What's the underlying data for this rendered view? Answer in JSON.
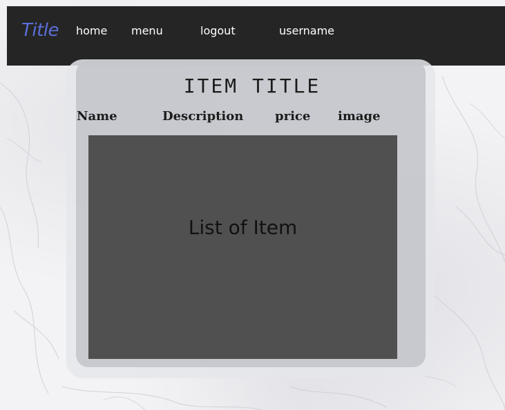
{
  "header": {
    "brand": "Title",
    "nav": {
      "home": "home",
      "menu": "menu",
      "logout": "logout",
      "username": "username"
    }
  },
  "card": {
    "title": "ITEM TITLE",
    "columns": [
      "Name",
      "Description",
      "price",
      "image"
    ],
    "list_placeholder": "List of Item"
  },
  "colors": {
    "topbar": "#252525",
    "brand": "#5b6fd8",
    "nav_text": "#ffffff",
    "list_panel": "#505050"
  }
}
